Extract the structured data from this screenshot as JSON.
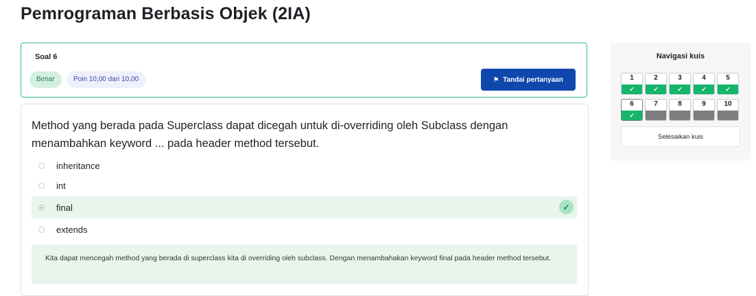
{
  "page": {
    "title": "Pemrograman Berbasis Objek (2IA)"
  },
  "question_info": {
    "number_label": "Soal 6",
    "state_badge": "Benar",
    "grade_badge": "Poin 10,00 dari 10,00",
    "flag_button_label": "Tandai pertanyaan",
    "flag_icon": "flag-icon"
  },
  "question": {
    "text": "Method yang berada pada Superclass dapat dicegah untuk di-overriding oleh Subclass dengan menambahkan keyword ... pada header method tersebut.",
    "answers": [
      {
        "label": "inheritance",
        "selected": false,
        "correct": false
      },
      {
        "label": "int",
        "selected": false,
        "correct": false
      },
      {
        "label": "final",
        "selected": true,
        "correct": true
      },
      {
        "label": "extends",
        "selected": false,
        "correct": false
      }
    ],
    "correct_icon": "check-circle-icon",
    "feedback": "Kita dapat mencegah method yang berada di superclass kita di overriding oleh subclass. Dengan menambahakan keyword final pada header method tersebut."
  },
  "quiz_nav": {
    "title": "Navigasi kuis",
    "buttons": [
      {
        "label": "1",
        "status": "answered"
      },
      {
        "label": "2",
        "status": "answered"
      },
      {
        "label": "3",
        "status": "answered"
      },
      {
        "label": "4",
        "status": "answered"
      },
      {
        "label": "5",
        "status": "answered"
      },
      {
        "label": "6",
        "status": "answered",
        "current": true
      },
      {
        "label": "7",
        "status": "not-answered"
      },
      {
        "label": "8",
        "status": "not-answered"
      },
      {
        "label": "9",
        "status": "not-answered"
      },
      {
        "label": "10",
        "status": "not-answered"
      }
    ],
    "finish_label": "Selesaikan kuis"
  },
  "colors": {
    "primary": "#0f47ad",
    "correct": "#15b66b",
    "correct_bg": "#e7f5ec",
    "info_border": "#2fbd7e",
    "not_answered": "#7d7d7d"
  }
}
